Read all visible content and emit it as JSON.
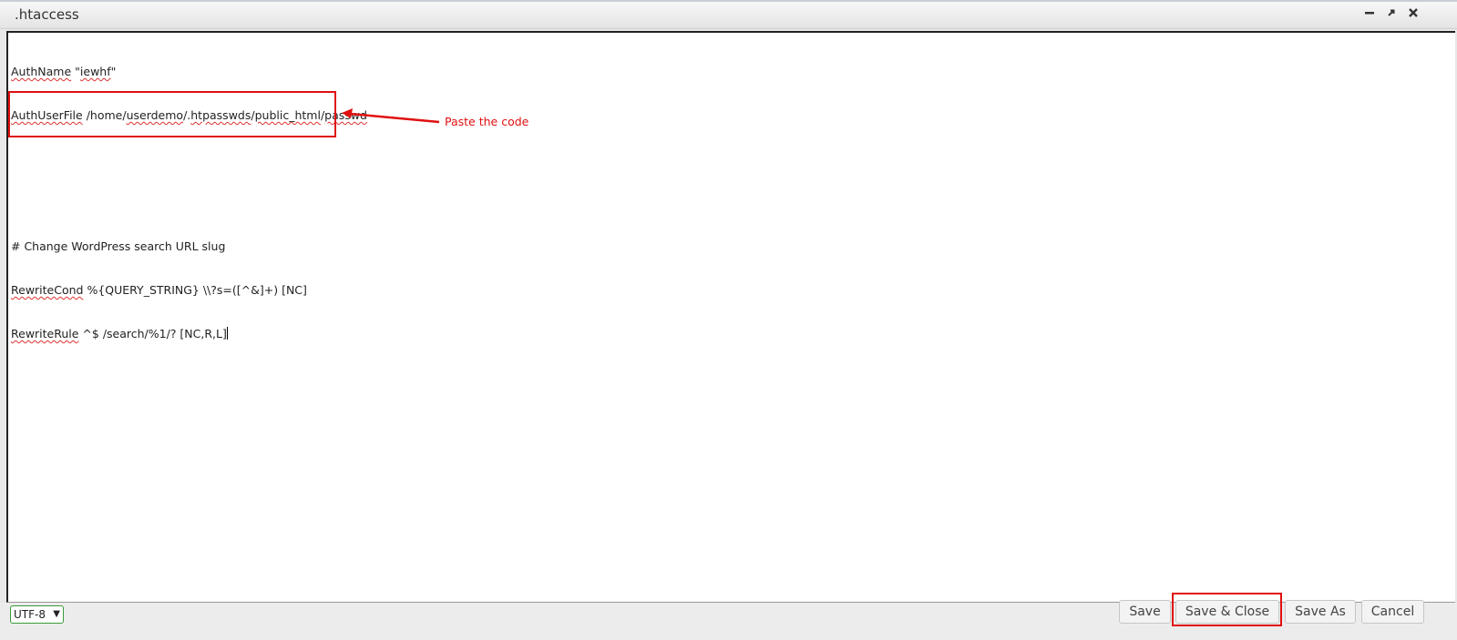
{
  "window": {
    "title": ".htaccess",
    "controls": [
      "minimize-icon",
      "restore-icon",
      "close-icon"
    ]
  },
  "editor": {
    "lines": [
      [
        "AuthName",
        " \"",
        "iewhf",
        "\""
      ],
      [
        "AuthUserFile",
        " /home/",
        "userdemo",
        "/.",
        "htpasswds",
        "/",
        "public_html",
        "/",
        "passwd",
        ""
      ],
      [
        ""
      ],
      [
        ""
      ],
      [
        "# Change WordPress search URL slug"
      ],
      [
        "RewriteCond",
        " %{QUERY_STRING} \\\\?s=([^&]+) [NC]"
      ],
      [
        "RewriteRule",
        " ^$ /search/%1/? [NC,R,L]"
      ]
    ]
  },
  "annotation": {
    "text": "Paste the code",
    "color": "#e01010"
  },
  "footer": {
    "encoding": "UTF-8",
    "buttons": {
      "save": "Save",
      "save_close": "Save & Close",
      "save_as": "Save As",
      "cancel": "Cancel"
    }
  }
}
